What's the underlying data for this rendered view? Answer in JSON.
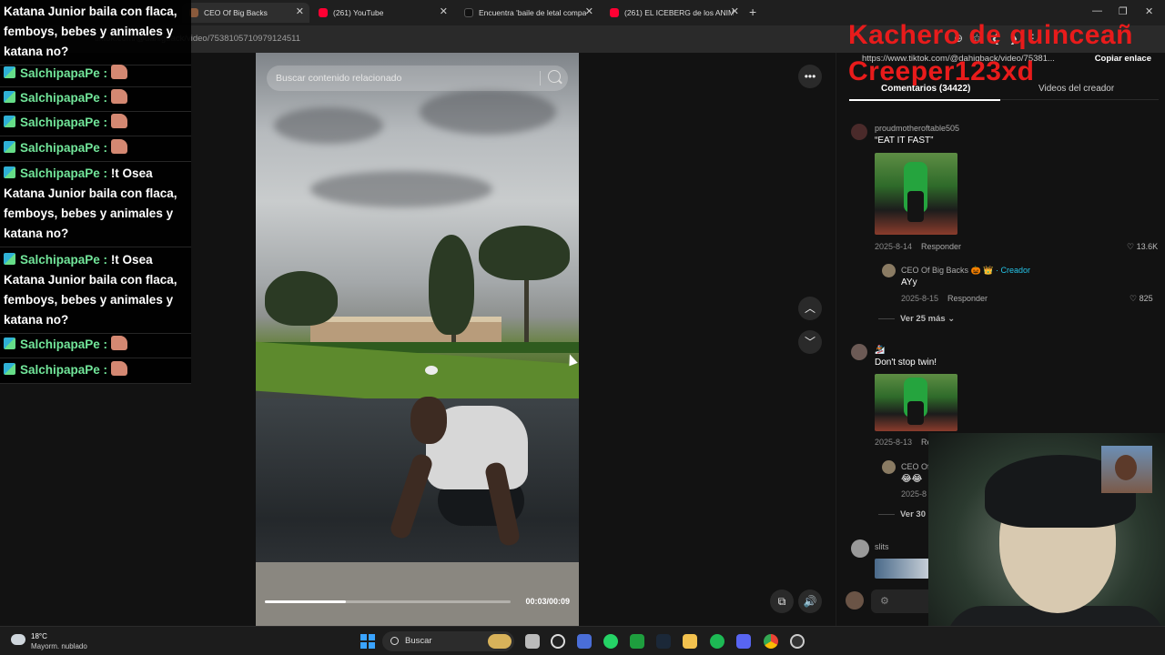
{
  "browser": {
    "tabs": [
      {
        "label": "CEO Of Big Backs",
        "color": "#8a5a3c",
        "active": true
      },
      {
        "label": "(261) YouTube",
        "color": "#ff0033",
        "active": false
      },
      {
        "label": "Encuentra 'baile de letal compa",
        "color": "#111111",
        "active": false
      },
      {
        "label": "(261) EL ICEBERG de los ANIMA",
        "color": "#ff0033",
        "active": false
      }
    ],
    "url": "tiktok.com/@dahigback/video/7538105710979124511"
  },
  "video": {
    "search_placeholder": "Buscar contenido relacionado",
    "time": "00:03/00:09",
    "progress": 0.33
  },
  "panel": {
    "link_url": "https://www.tiktok.com/@dahigback/video/75381...",
    "copy_label": "Copiar enlace",
    "tab_comments": "Comentarios (34422)",
    "tab_creator": "Videos del creador",
    "comments": [
      {
        "user": "proudmotheroftable505",
        "text": "“EAT IT FAST”",
        "date": "2025-8-14",
        "reply": "Responder",
        "likes": "13.6K"
      },
      {
        "user": "CEO Of Big Backs 🎃 👑",
        "creator_label": "· Creador",
        "text": "AYy",
        "date": "2025-8-15",
        "reply": "Responder",
        "likes": "825",
        "more": "Ver 25 más"
      },
      {
        "user": "🏂",
        "text": "Don't stop twin!",
        "date": "2025-8-13",
        "reply": "Re",
        "sub_user": "CEO Of",
        "sub_text": "😂😂",
        "sub_date": "2025-8",
        "more": "Ver 30 r"
      },
      {
        "user": "slits"
      }
    ]
  },
  "chat": {
    "messages": [
      {
        "name": "Katana Junior baila con flaca, femboys, bebes y animales y katana no?",
        "text": "",
        "partial": true
      },
      {
        "name": "SalchipapaPe :",
        "text": ""
      },
      {
        "name": "SalchipapaPe :",
        "text": ""
      },
      {
        "name": "SalchipapaPe :",
        "text": ""
      },
      {
        "name": "SalchipapaPe :",
        "text": ""
      },
      {
        "name": "SalchipapaPe :",
        "text": "!t Osea Katana Junior baila con flaca, femboys, bebes y animales y katana no?"
      },
      {
        "name": "SalchipapaPe :",
        "text": "!t Osea Katana Junior baila con flaca, femboys, bebes y animales y katana no?"
      },
      {
        "name": "SalchipapaPe :",
        "text": ""
      },
      {
        "name": "SalchipapaPe :",
        "text": ""
      }
    ]
  },
  "overlay": {
    "line1": "Kachero de quinceañ",
    "line2": "Creeper123xd"
  },
  "taskbar": {
    "temp": "18°C",
    "weather": "Mayorm. nublado",
    "search": "Buscar"
  }
}
